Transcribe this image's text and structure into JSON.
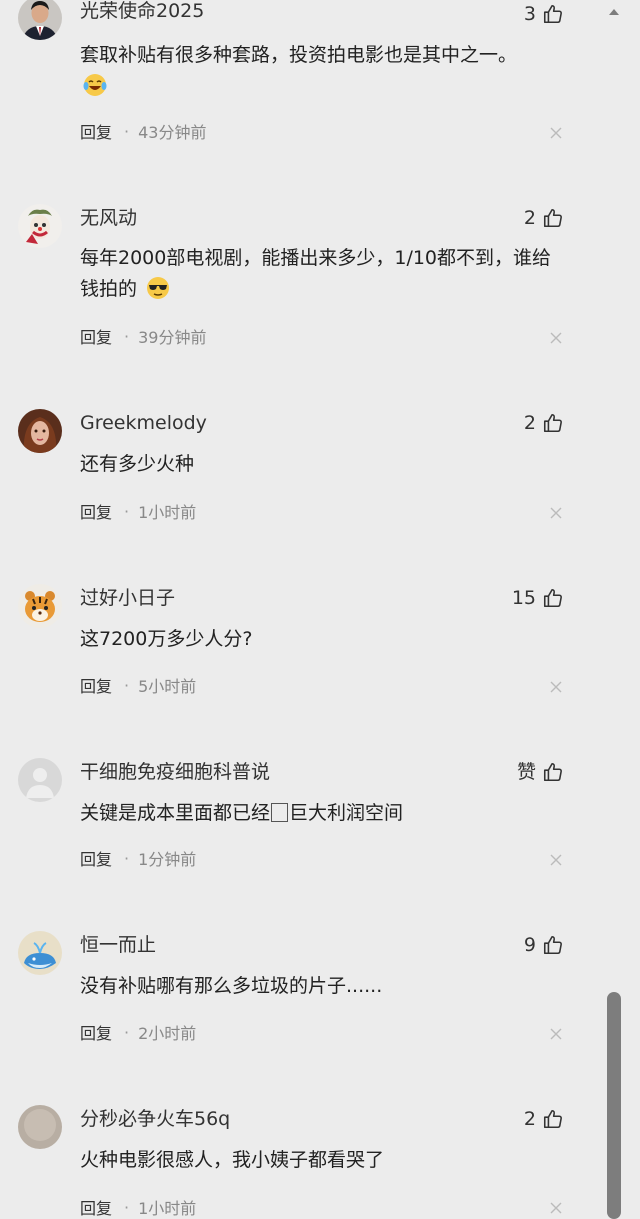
{
  "comments": [
    {
      "username": "光荣使命2025",
      "likes": "3",
      "text": "套取补贴有很多种套路，投资拍电影也是其中之一。",
      "emoji": "laughing-crying-emoji",
      "reply": "回复",
      "time": "43分钟前",
      "avatar": "man-in-suit-avatar"
    },
    {
      "username": "无风动",
      "likes": "2",
      "text": "每年2000部电视剧，能播出来多少，1/10都不到，谁给钱拍的",
      "emoji": "sunglasses-emoji",
      "reply": "回复",
      "time": "39分钟前",
      "avatar": "clown-avatar"
    },
    {
      "username": "Greekmelody",
      "likes": "2",
      "text": "还有多少火种",
      "reply": "回复",
      "time": "1小时前",
      "avatar": "woman-portrait-avatar"
    },
    {
      "username": "过好小日子",
      "likes": "15",
      "text": "这7200万多少人分?",
      "reply": "回复",
      "time": "5小时前",
      "avatar": "tiger-avatar"
    },
    {
      "username": "干细胞免疫细胞科普说",
      "likes": "赞",
      "text_before": "关键是成本里面都已经",
      "text_after": "巨大利润空间",
      "reply": "回复",
      "time": "1分钟前",
      "avatar": "default-user-avatar"
    },
    {
      "username": "恒一而止",
      "likes": "9",
      "text": "没有补贴哪有那么多垃圾的片子......",
      "reply": "回复",
      "time": "2小时前",
      "avatar": "whale-avatar"
    },
    {
      "username": "分秒必争火车56q",
      "likes": "2",
      "text": "火种电影很感人，我小姨子都看哭了",
      "reply": "回复",
      "time": "1小时前",
      "avatar": "beige-circle-avatar"
    }
  ],
  "colors": {
    "background": "#ececec",
    "text": "#222222",
    "meta": "#888888",
    "scrollbar": "#7d7d7d"
  }
}
